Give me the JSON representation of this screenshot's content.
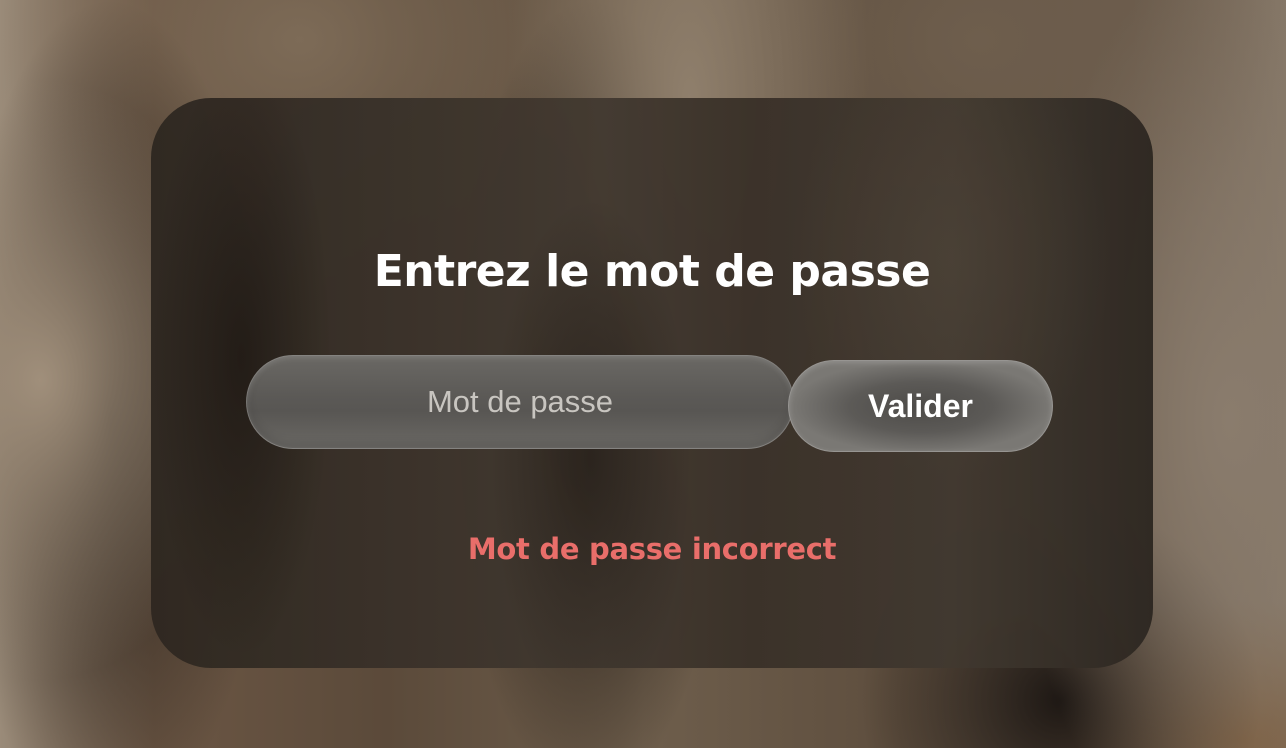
{
  "dialog": {
    "title": "Entrez le mot de passe",
    "password_field": {
      "placeholder": "Mot de passe",
      "value": ""
    },
    "submit_label": "Valider",
    "error_text": "Mot de passe incorrect",
    "error_color": "#e96e6a"
  }
}
